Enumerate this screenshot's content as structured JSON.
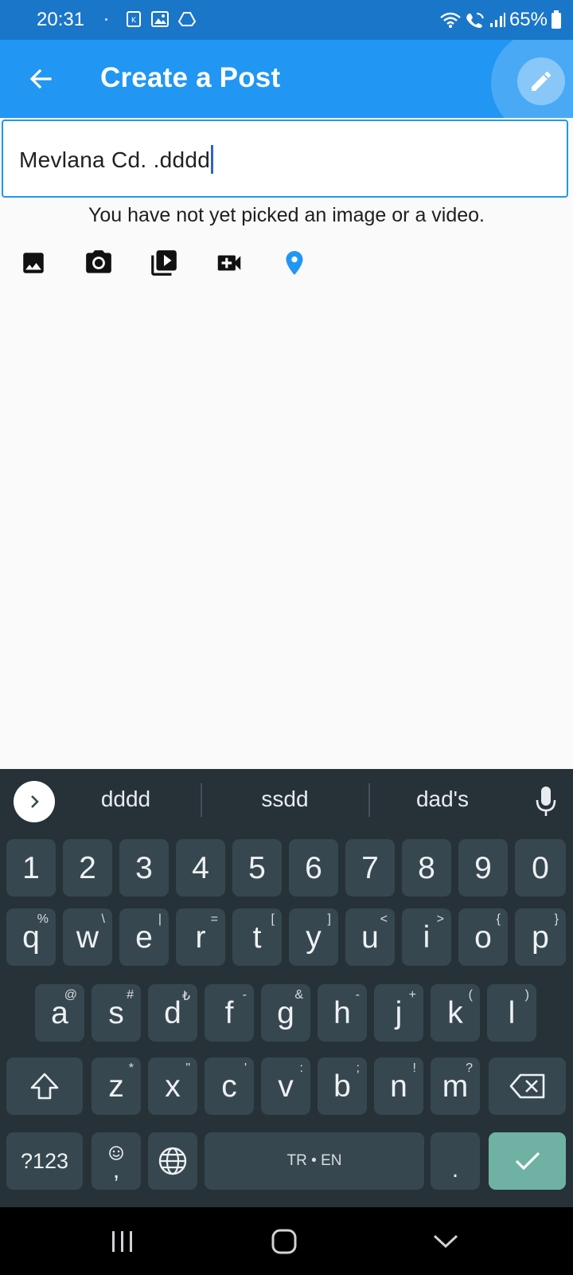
{
  "status_bar": {
    "time": "20:31",
    "battery": "65%"
  },
  "app_bar": {
    "title": "Create a Post",
    "back_icon": "arrow-back-icon",
    "edit_icon": "pencil-icon",
    "background": "#2196f3"
  },
  "post_input": {
    "value": "Mevlana Cd. .dddd"
  },
  "media": {
    "message": "You have not yet picked an image or a video.",
    "buttons": [
      "image-icon",
      "camera-icon",
      "video-library-icon",
      "video-camera-add-icon",
      "location-pin-icon"
    ]
  },
  "keyboard": {
    "suggestions": [
      "dddd",
      "ssdd",
      "dad's"
    ],
    "number_row": [
      "1",
      "2",
      "3",
      "4",
      "5",
      "6",
      "7",
      "8",
      "9",
      "0"
    ],
    "row1": [
      {
        "key": "q",
        "hint": "%"
      },
      {
        "key": "w",
        "hint": "\\"
      },
      {
        "key": "e",
        "hint": "|"
      },
      {
        "key": "r",
        "hint": "="
      },
      {
        "key": "t",
        "hint": "["
      },
      {
        "key": "y",
        "hint": "]"
      },
      {
        "key": "u",
        "hint": "<"
      },
      {
        "key": "i",
        "hint": ">"
      },
      {
        "key": "o",
        "hint": "{"
      },
      {
        "key": "p",
        "hint": "}"
      }
    ],
    "row2": [
      {
        "key": "a",
        "hint": "@"
      },
      {
        "key": "s",
        "hint": "#"
      },
      {
        "key": "d",
        "hint": "₺"
      },
      {
        "key": "f",
        "hint": "-"
      },
      {
        "key": "g",
        "hint": "&"
      },
      {
        "key": "h",
        "hint": "-"
      },
      {
        "key": "j",
        "hint": "+"
      },
      {
        "key": "k",
        "hint": "("
      },
      {
        "key": "l",
        "hint": ")"
      }
    ],
    "row3": [
      {
        "key": "z",
        "hint": "*"
      },
      {
        "key": "x",
        "hint": "\""
      },
      {
        "key": "c",
        "hint": "'"
      },
      {
        "key": "v",
        "hint": ":"
      },
      {
        "key": "b",
        "hint": ";"
      },
      {
        "key": "n",
        "hint": "!"
      },
      {
        "key": "m",
        "hint": "?"
      }
    ],
    "symbols_label": "?123",
    "comma": ",",
    "space_label": "TR • EN",
    "period": ".",
    "accent": "#6fb2a4"
  }
}
